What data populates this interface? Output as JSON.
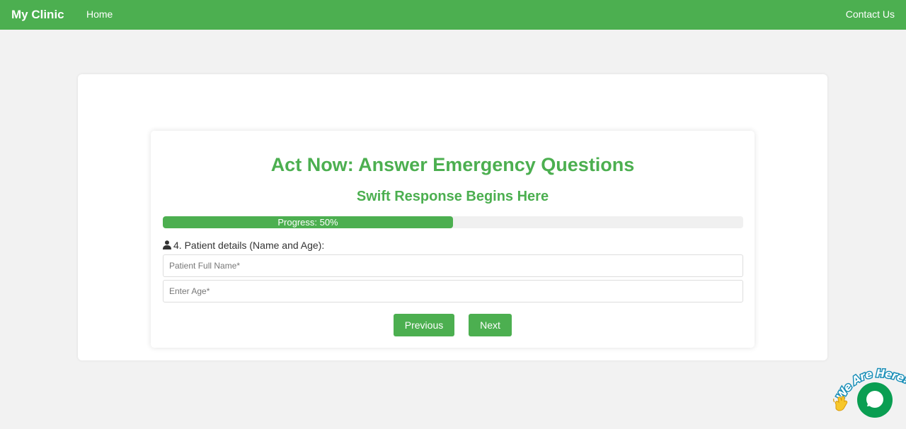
{
  "nav": {
    "brand": "My Clinic",
    "home": "Home",
    "contact": "Contact Us"
  },
  "form": {
    "title": "Act Now: Answer Emergency Questions",
    "subtitle": "Swift Response Begins Here",
    "progress": {
      "label": "Progress: 50%",
      "value": 0.5
    },
    "question": {
      "icon": "user-icon",
      "label": "4. Patient details (Name and Age):"
    },
    "name_field": {
      "value": "",
      "placeholder": "Patient Full Name*"
    },
    "age_field": {
      "value": "",
      "placeholder": "Enter Age*"
    },
    "previous_label": "Previous",
    "next_label": "Next"
  },
  "chat_widget": {
    "tagline": "We Are Here!",
    "icon": "chat-bubble-icon",
    "wave_icon": "waving-hand-icon"
  },
  "colors": {
    "primary": "#4caf50",
    "chat": "#0a9e52",
    "background": "#f2f2f2"
  }
}
